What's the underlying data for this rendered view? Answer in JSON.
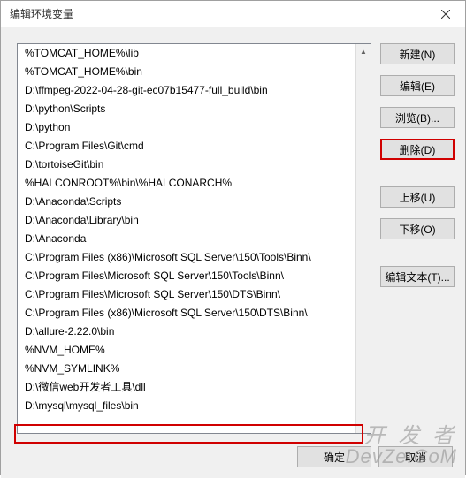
{
  "window": {
    "title": "编辑环境变量"
  },
  "list": {
    "items": [
      "%TOMCAT_HOME%\\lib",
      "%TOMCAT_HOME%\\bin",
      "D:\\ffmpeg-2022-04-28-git-ec07b15477-full_build\\bin",
      "D:\\python\\Scripts",
      "D:\\python",
      "C:\\Program Files\\Git\\cmd",
      "D:\\tortoiseGit\\bin",
      "%HALCONROOT%\\bin\\%HALCONARCH%",
      "D:\\Anaconda\\Scripts",
      "D:\\Anaconda\\Library\\bin",
      "D:\\Anaconda",
      "C:\\Program Files (x86)\\Microsoft SQL Server\\150\\Tools\\Binn\\",
      "C:\\Program Files\\Microsoft SQL Server\\150\\Tools\\Binn\\",
      "C:\\Program Files\\Microsoft SQL Server\\150\\DTS\\Binn\\",
      "C:\\Program Files (x86)\\Microsoft SQL Server\\150\\DTS\\Binn\\",
      "D:\\allure-2.22.0\\bin",
      "%NVM_HOME%",
      "%NVM_SYMLINK%",
      "D:\\微信web开发者工具\\dll",
      "D:\\mysql\\mysql_files\\bin"
    ]
  },
  "buttons": {
    "new": "新建(N)",
    "edit": "编辑(E)",
    "browse": "浏览(B)...",
    "delete": "删除(D)",
    "moveup": "上移(U)",
    "movedown": "下移(O)",
    "edittext": "编辑文本(T)...",
    "ok": "确定",
    "cancel": "取消"
  },
  "watermark": {
    "line1": "开 发 者",
    "line2": "DevZe.CoM"
  }
}
